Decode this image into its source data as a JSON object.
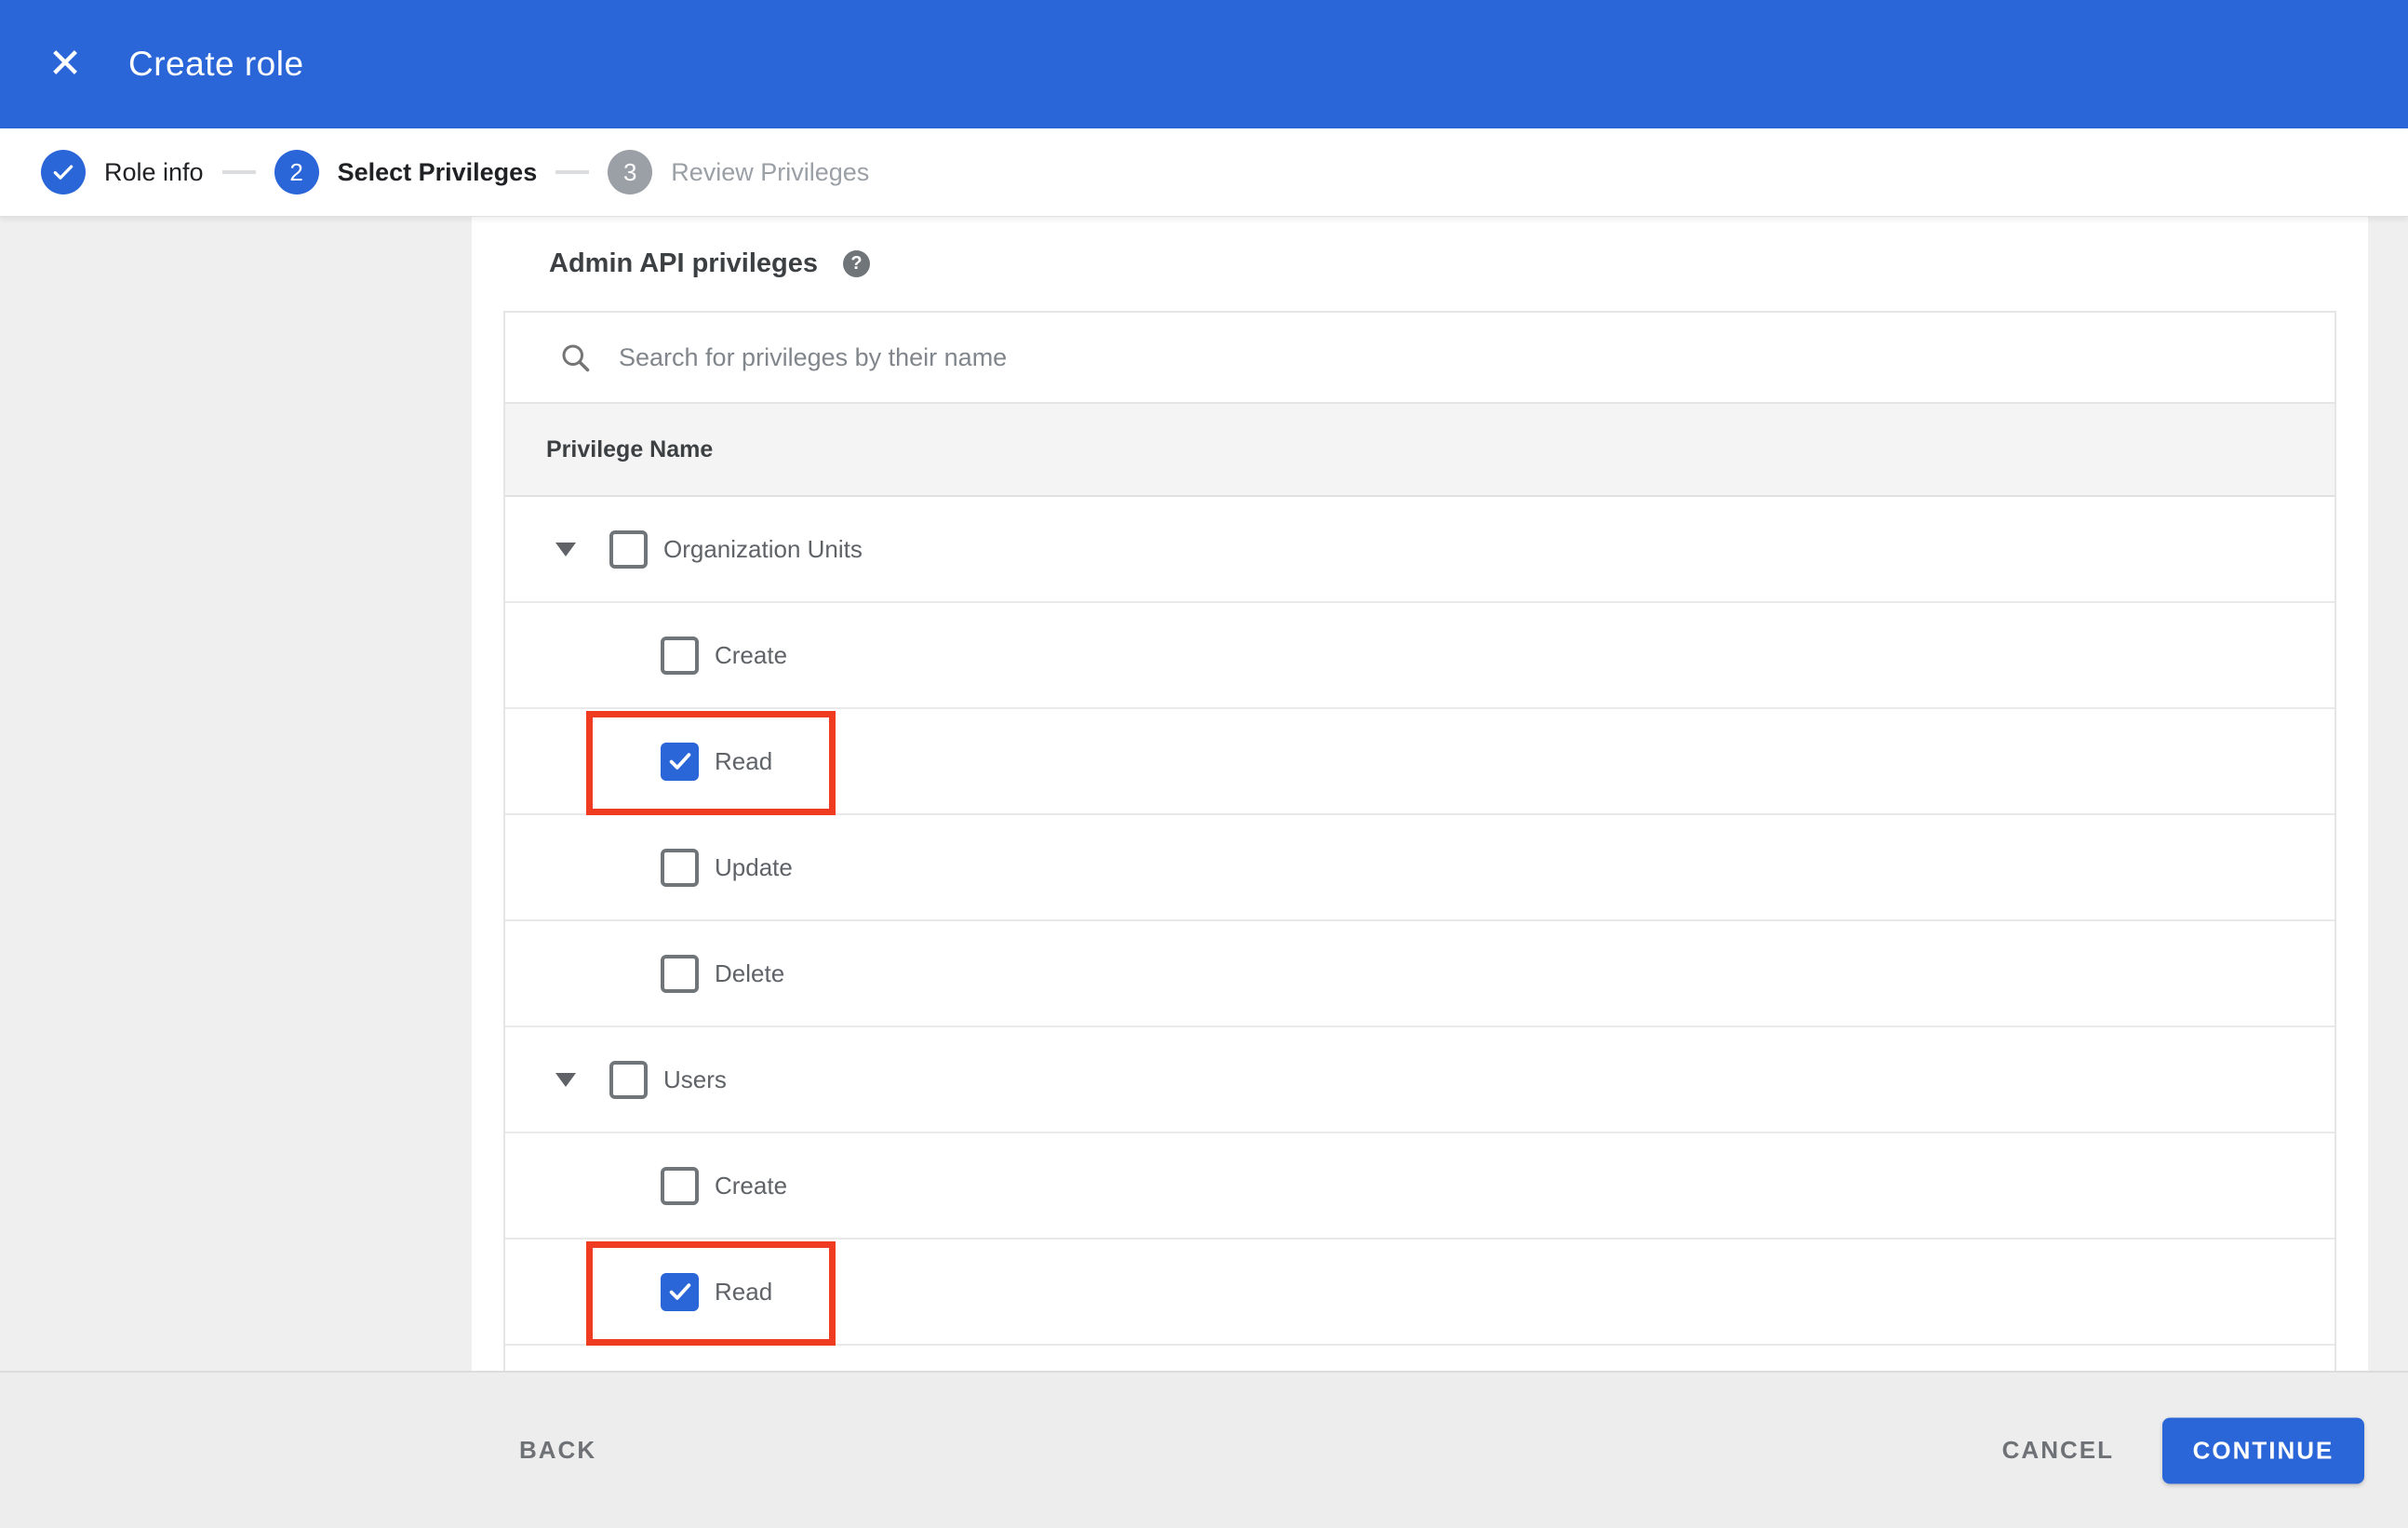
{
  "app_bar": {
    "title": "Create role"
  },
  "icons": {
    "close": "✕",
    "help": "?"
  },
  "stepper": {
    "steps": [
      {
        "number": "",
        "label": "Role info",
        "state": "completed"
      },
      {
        "number": "2",
        "label": "Select Privileges",
        "state": "current"
      },
      {
        "number": "3",
        "label": "Review Privileges",
        "state": "upcoming"
      }
    ]
  },
  "content": {
    "heading": "Admin API privileges",
    "search_placeholder": "Search for privileges by their name",
    "table_header": "Privilege Name",
    "groups": [
      {
        "label": "Organization Units",
        "checked": false,
        "children": [
          {
            "label": "Create",
            "checked": false,
            "highlighted": false
          },
          {
            "label": "Read",
            "checked": true,
            "highlighted": true
          },
          {
            "label": "Update",
            "checked": false,
            "highlighted": false
          },
          {
            "label": "Delete",
            "checked": false,
            "highlighted": false
          }
        ]
      },
      {
        "label": "Users",
        "checked": false,
        "children": [
          {
            "label": "Create",
            "checked": false,
            "highlighted": false
          },
          {
            "label": "Read",
            "checked": true,
            "highlighted": true
          }
        ]
      }
    ]
  },
  "footer": {
    "back_label": "BACK",
    "cancel_label": "CANCEL",
    "continue_label": "CONTINUE"
  },
  "colors": {
    "accent_blue": "#2b66d9",
    "highlight_red": "#ef3b20",
    "step_inactive_gray": "#9aa0a6"
  }
}
